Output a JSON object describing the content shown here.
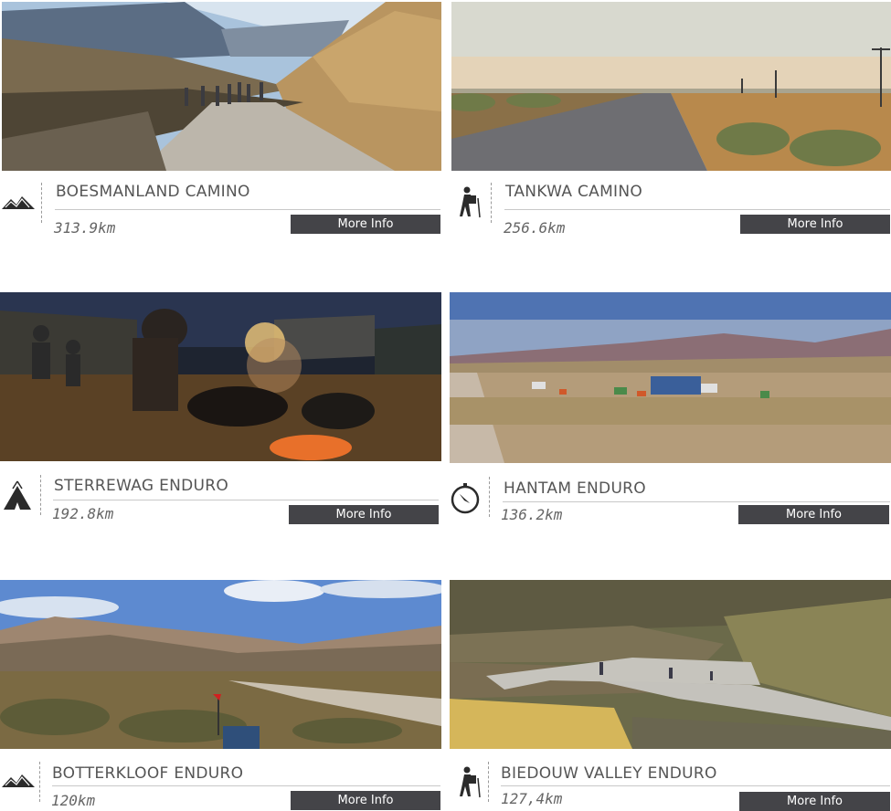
{
  "routes": [
    {
      "name": "BOESMANLAND CAMINO",
      "distance": "313.9km",
      "button": "More Info",
      "icon": "mountain-range-icon"
    },
    {
      "name": "TANKWA CAMINO",
      "distance": "256.6km",
      "button": "More Info",
      "icon": "hiker-icon"
    },
    {
      "name": "STERREWAG ENDURO",
      "distance": "192.8km",
      "button": "More Info",
      "icon": "tent-icon"
    },
    {
      "name": "HANTAM ENDURO",
      "distance": "136.2km",
      "button": "More Info",
      "icon": "compass-icon"
    },
    {
      "name": "BOTTERKLOOF ENDURO",
      "distance": "120km",
      "button": "More Info",
      "icon": "mountain-range-icon"
    },
    {
      "name": "BIEDOUW VALLEY ENDURO",
      "distance": "127,4km",
      "button": "More Info",
      "icon": "hiker-icon"
    }
  ]
}
